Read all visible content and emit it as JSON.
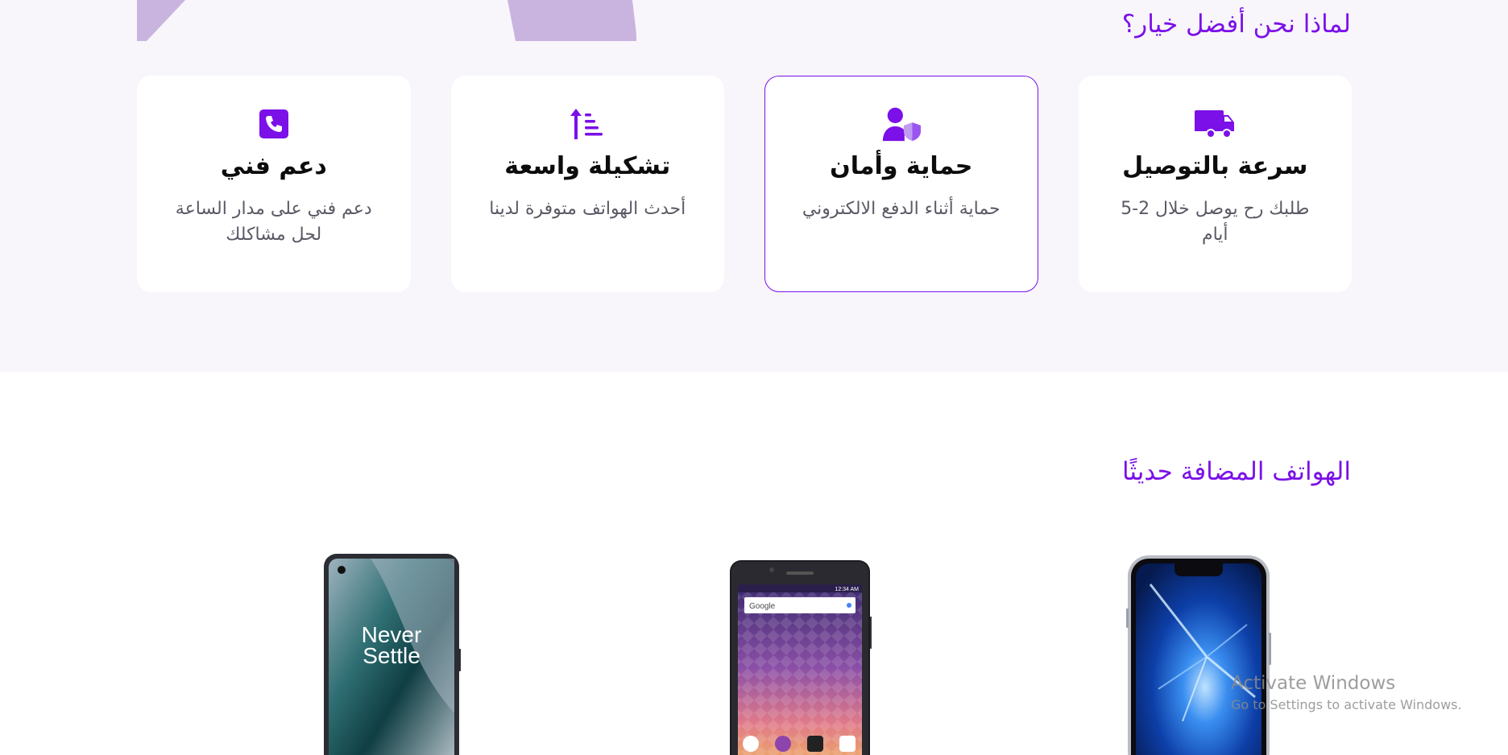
{
  "colors": {
    "accent": "#7b10e8",
    "section_bg": "#f8f6fb",
    "hero_shape": "#c9b4df"
  },
  "why_section": {
    "heading": "لماذا نحن أفضل خيار؟",
    "features": [
      {
        "icon": "truck-icon",
        "title": "سرعة بالتوصيل",
        "desc": "طلبك رح يوصل خلال 2-5 أيام",
        "active": false
      },
      {
        "icon": "user-shield-icon",
        "title": "حماية وأمان",
        "desc": "حماية أثناء الدفع الالكتروني",
        "active": true
      },
      {
        "icon": "sort-up-icon",
        "title": "تشكيلة واسعة",
        "desc": "أحدث الهواتف متوفرة لدينا",
        "active": false
      },
      {
        "icon": "phone-icon",
        "title": "دعم فني",
        "desc": "دعم فني على مدار الساعة لحل مشاكلك",
        "active": false
      }
    ]
  },
  "new_phones": {
    "heading": "الهواتف المضافة حديثًا",
    "products": [
      {
        "name": "iphone-product-image"
      },
      {
        "name": "blu-phone-product-image",
        "screen_search": "Google",
        "status_time": "12:34 AM"
      },
      {
        "name": "oneplus-product-image",
        "screen_text": "Never Settle"
      }
    ]
  },
  "watermark": {
    "title": "Activate Windows",
    "subtitle": "Go to Settings to activate Windows."
  }
}
